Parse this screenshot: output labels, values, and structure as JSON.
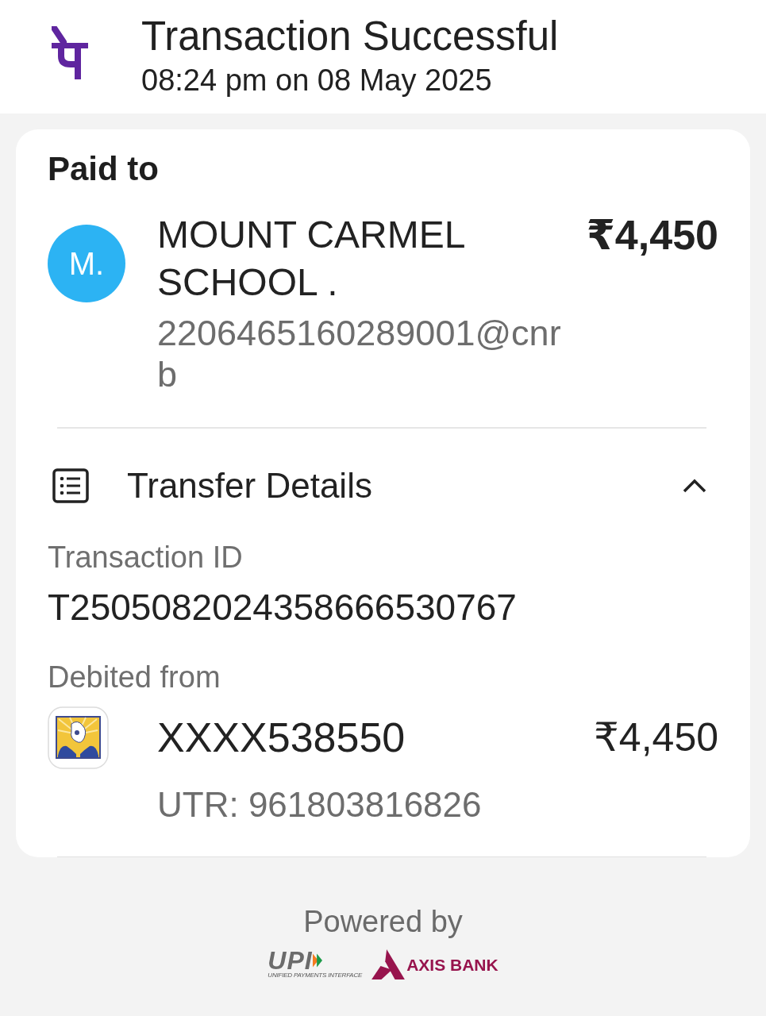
{
  "header": {
    "title": "Transaction Successful",
    "timestamp": "08:24 pm on 08 May 2025"
  },
  "paid_to": {
    "heading": "Paid to",
    "avatar_initials": "M.",
    "name": "MOUNT CARMEL SCHOOL .",
    "upi_id": "2206465160289001@cnrb",
    "amount": "₹4,450"
  },
  "transfer_details": {
    "title": "Transfer Details",
    "expanded": true,
    "transaction_id_label": "Transaction ID",
    "transaction_id": "T2505082024358666530767",
    "debited_from_label": "Debited from",
    "account": "XXXX538550",
    "amount": "₹4,450",
    "utr": "UTR: 961803816826"
  },
  "footer": {
    "powered_by": "Powered by",
    "upi_logo": "UPI",
    "upi_tagline": "UNIFIED PAYMENTS INTERFACE",
    "bank_name": "AXIS BANK"
  }
}
